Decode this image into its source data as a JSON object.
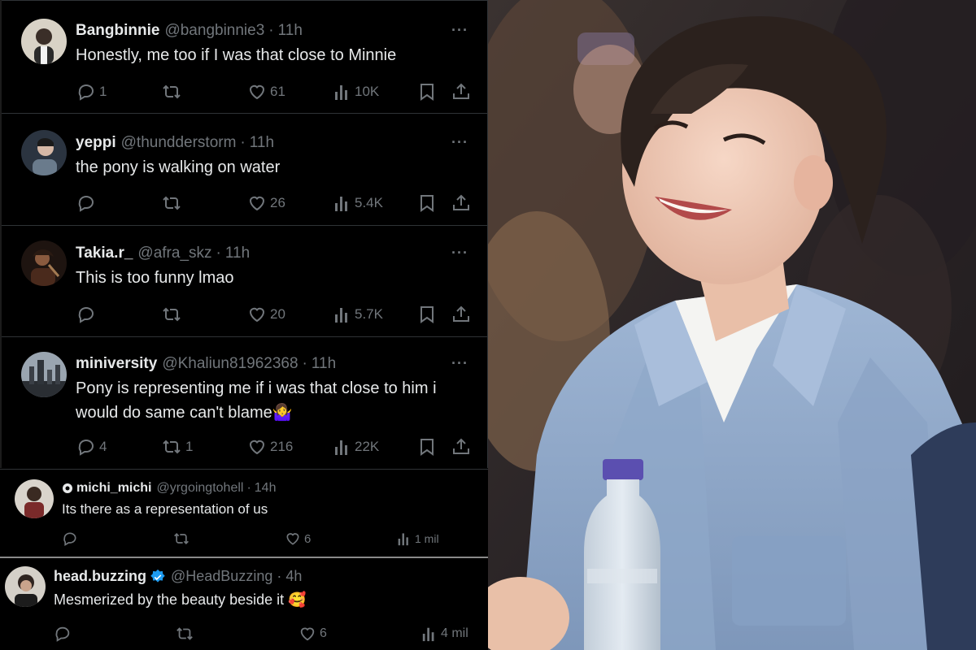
{
  "tweets": [
    {
      "name": "Bangbinnie",
      "handle": "@bangbinnie3",
      "time": "11h",
      "text": "Honestly, me too if I was that close to Minnie",
      "replies": "1",
      "retweets": "",
      "likes": "61",
      "views": "10K"
    },
    {
      "name": "yeppi",
      "handle": "@thundderstorm",
      "time": "11h",
      "text": "the pony is walking on water",
      "replies": "",
      "retweets": "",
      "likes": "26",
      "views": "5.4K"
    },
    {
      "name": "Takia.r_",
      "handle": "@afra_skz",
      "time": "11h",
      "text": "This is too funny lmao",
      "replies": "",
      "retweets": "",
      "likes": "20",
      "views": "5.7K"
    },
    {
      "name": "miniversity",
      "handle": "@Khaliun81962368",
      "time": "11h",
      "text_line1": "Pony is representing me if i was that close to him i",
      "text_line2": "would do same can't blame",
      "emoji": "🤷‍♀️",
      "replies": "4",
      "retweets": "1",
      "likes": "216",
      "views": "22K"
    }
  ],
  "tweet_b": {
    "name": "michi_michi",
    "handle": "@yrgoingtohell",
    "time": "14h",
    "text": "Its there as a representation of us",
    "likes": "6",
    "views": "1 mil"
  },
  "tweet_c": {
    "name": "head.buzzing",
    "handle": "@HeadBuzzing",
    "time": "4h",
    "text": "Mesmerized by the beauty beside it",
    "emoji": "🥰",
    "likes": "6",
    "views": "4 mil"
  },
  "separator": "·",
  "more_label": "···",
  "colors": {
    "background": "#000000",
    "text": "#e7e9ea",
    "muted": "#71767b",
    "divider": "#2f3336",
    "verified": "#1d9bf0"
  },
  "icons": [
    "reply-icon",
    "retweet-icon",
    "like-icon",
    "views-icon",
    "bookmark-icon",
    "share-icon",
    "verified-icon",
    "circle-badge-icon",
    "more-icon"
  ]
}
